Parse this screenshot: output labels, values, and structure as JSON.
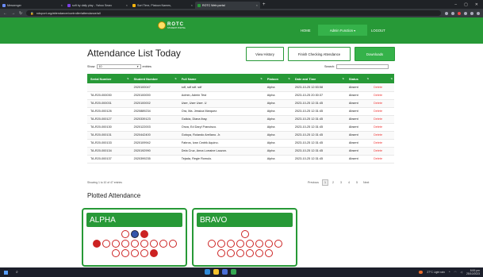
{
  "browser": {
    "tabs": [
      {
        "label": "Messenger"
      },
      {
        "label": "soft by daily play - Yahoo Searc"
      },
      {
        "label": "Sort Time, Platoon Names,"
      },
      {
        "label": "ROTC Web portal",
        "active": true
      }
    ],
    "url": "rotcport.org/attendance/controller/attendance/all"
  },
  "site": {
    "logo_title": "ROTC",
    "logo_subtitle": "STUDENT PORTAL",
    "nav": {
      "home": "HOME",
      "admin": "Admin Function ▾",
      "logout": "LOGOUT"
    }
  },
  "main": {
    "title": "Attendance List Today",
    "buttons": {
      "history": "View History",
      "finish": "Finish Checking Attendance",
      "download": "Downloads"
    },
    "show_label": "Show",
    "entries_value": "10",
    "entries_label": "entries",
    "search_label": "Search:",
    "table": {
      "headers": [
        "Serial Number",
        "Student Number",
        "Full Name",
        "Platoon",
        "Date and Time",
        "Status",
        ""
      ],
      "rows": [
        [
          "",
          "2020100047",
          "sdf, sdf sdf. sdf",
          "Alpha",
          "2023-10-25 12:53:58",
          "Absent",
          "Delete"
        ],
        [
          "TA-R20-000030",
          "2020100000",
          "Admin, Admin Test",
          "Alpha",
          "2023-10-25 20:30:37",
          "Absent",
          "Delete"
        ],
        [
          "TA-R20-000031",
          "2020100002",
          "User, User User. U",
          "Alpha",
          "2023-10-25 12:31:45",
          "Absent",
          "Delete"
        ],
        [
          "TA-R20-000126",
          "2020889234",
          "Ora, Ma. Jessica Marquez.",
          "Alpha",
          "2023-10-25 12:31:45",
          "Absent",
          "Delete"
        ],
        [
          "TA-R20-000127",
          "2020339123",
          "Galicia, Diana Ibay.",
          "Alpha",
          "2023-10-25 12:31:45",
          "Absent",
          "Delete"
        ],
        [
          "TA-R20-000130",
          "2020122003",
          "Onza, Ed Daryl Francisco.",
          "Alpha",
          "2023-10-25 12:31:45",
          "Absent",
          "Delete"
        ],
        [
          "TA-R20-000131",
          "2020442400",
          "Gotoya, Rolando Arellano. Jr.",
          "Alpha",
          "2023-10-25 12:31:45",
          "Absent",
          "Delete"
        ],
        [
          "TA-R20-000133",
          "2020109942",
          "Fabros, Ivan Cedrik Aquino.",
          "Alpha",
          "2023-10-25 12:31:45",
          "Absent",
          "Delete"
        ],
        [
          "TA-R20-000134",
          "2020192990",
          "Dela Cruz, Anna Lorraine Lauzon.",
          "Alpha",
          "2023-10-25 12:31:45",
          "Absent",
          "Delete"
        ],
        [
          "TA-R20-000137",
          "2020399235",
          "Tejada, Regie Romulo.",
          "Alpha",
          "2023-10-25 12:31:45",
          "Absent",
          "Delete"
        ]
      ]
    },
    "info": "Showing 1 to 10 of 47 entries",
    "pager": [
      "Previous",
      "1",
      "2",
      "3",
      "4",
      "5",
      "Next"
    ],
    "plotted_title": "Plotted Attendance",
    "platoons": [
      {
        "name": "ALPHA"
      },
      {
        "name": "BRAVO"
      }
    ]
  },
  "taskbar": {
    "weather": "27°C Light rain",
    "time": "8:55 pm",
    "date": "25/10/2023"
  },
  "colors": {
    "brand_green": "#279937",
    "accent_green": "#35b24a",
    "delete_red": "#e33333"
  }
}
